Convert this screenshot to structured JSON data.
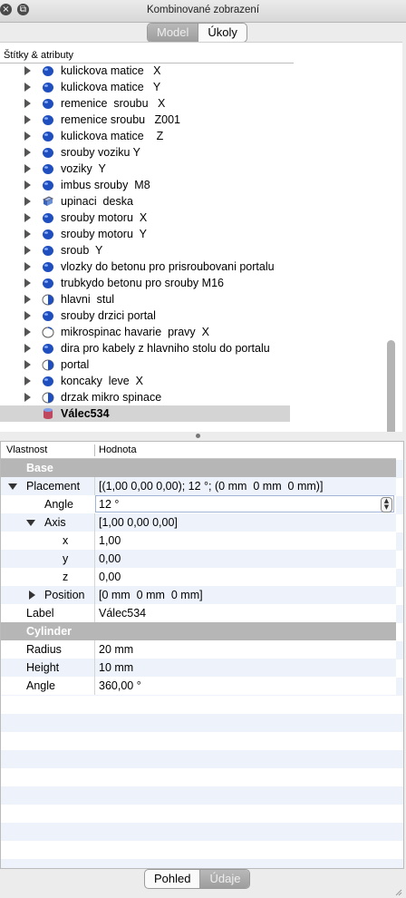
{
  "window": {
    "title": "Kombinované zobrazení"
  },
  "top_tabs": {
    "model": "Model",
    "tasks": "Úkoly"
  },
  "tree": {
    "header": "Štítky & atributy",
    "items": [
      {
        "label": "kulickova matice   X",
        "icon": "solid-icon"
      },
      {
        "label": "kulickova matice   Y",
        "icon": "solid-icon"
      },
      {
        "label": "remenice  sroubu   X",
        "icon": "solid-icon"
      },
      {
        "label": "remenice sroubu   Z001",
        "icon": "solid-icon"
      },
      {
        "label": "kulickova matice    Z",
        "icon": "solid-icon"
      },
      {
        "label": "srouby voziku Y",
        "icon": "solid-icon"
      },
      {
        "label": "voziky  Y",
        "icon": "solid-icon"
      },
      {
        "label": "imbus srouby  M8",
        "icon": "solid-icon"
      },
      {
        "label": "upinaci  deska",
        "icon": "part-icon"
      },
      {
        "label": "srouby motoru  X",
        "icon": "solid-icon"
      },
      {
        "label": "srouby motoru  Y",
        "icon": "solid-icon"
      },
      {
        "label": "sroub  Y",
        "icon": "solid-icon"
      },
      {
        "label": "vlozky do betonu pro prisroubovani portalu",
        "icon": "solid-icon"
      },
      {
        "label": "trubkydo betonu pro srouby M16",
        "icon": "solid-icon"
      },
      {
        "label": "hlavni  stul",
        "icon": "half-solid-icon"
      },
      {
        "label": "srouby drzici portal",
        "icon": "solid-icon"
      },
      {
        "label": "mikrospinac havarie  pravy  X",
        "icon": "empty-icon"
      },
      {
        "label": "dira pro kabely z hlavniho stolu do portalu",
        "icon": "solid-icon"
      },
      {
        "label": "portal",
        "icon": "half-solid-icon"
      },
      {
        "label": "koncaky  leve  X",
        "icon": "solid-icon"
      },
      {
        "label": "drzak mikro spinace",
        "icon": "half-solid-icon"
      }
    ],
    "selected": {
      "label": "Válec534",
      "icon": "cylinder-icon"
    }
  },
  "properties": {
    "col_property": "Vlastnost",
    "col_value": "Hodnota",
    "base_group": "Base",
    "placement": {
      "label": "Placement",
      "value": "[(1,00 0,00 0,00); 12 °; (0 mm  0 mm  0 mm)]"
    },
    "angle": {
      "label": "Angle",
      "value": "12 °"
    },
    "axis": {
      "label": "Axis",
      "value": "[1,00 0,00 0,00]"
    },
    "axis_x": {
      "label": "x",
      "value": "1,00"
    },
    "axis_y": {
      "label": "y",
      "value": "0,00"
    },
    "axis_z": {
      "label": "z",
      "value": "0,00"
    },
    "position": {
      "label": "Position",
      "value": "[0 mm  0 mm  0 mm]"
    },
    "label_prop": {
      "label": "Label",
      "value": "Válec534"
    },
    "cylinder_group": "Cylinder",
    "radius": {
      "label": "Radius",
      "value": "20 mm"
    },
    "height": {
      "label": "Height",
      "value": "10 mm"
    },
    "cyl_angle": {
      "label": "Angle",
      "value": "360,00 °"
    }
  },
  "bottom_tabs": {
    "view": "Pohled",
    "data": "Údaje"
  },
  "colors": {
    "accent_blue": "#1f4fbf",
    "group_header": "#b6b6b6",
    "selection": "#d4d4d4"
  }
}
